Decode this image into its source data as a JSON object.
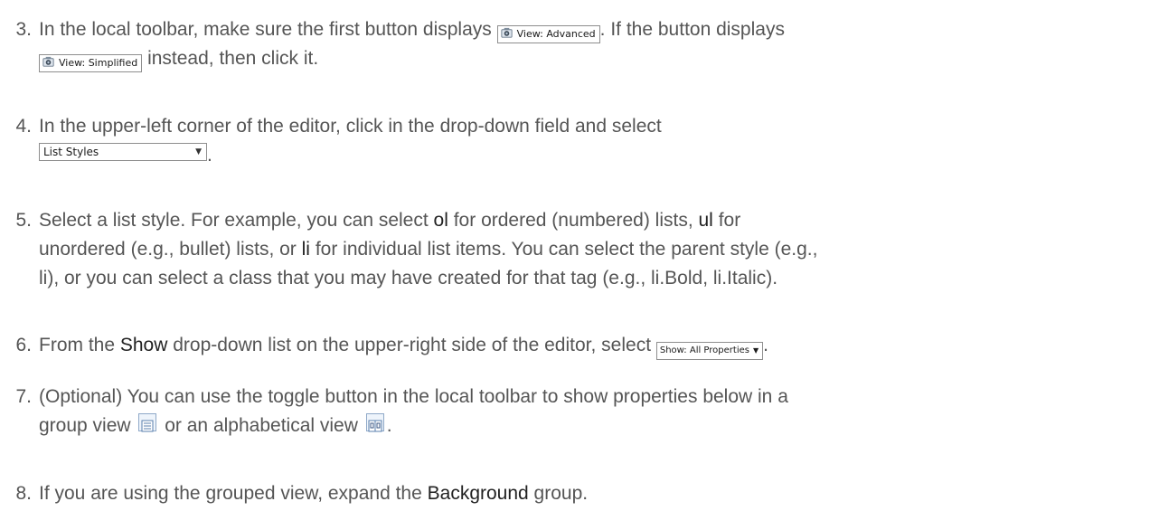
{
  "steps": [
    {
      "number": "3.",
      "part1": "In the local toolbar, make sure the first button displays",
      "btn_advanced": "View: Advanced",
      "part2": ". If the button displays",
      "btn_simplified": "View: Simplified",
      "part3": "instead, then click it."
    },
    {
      "number": "4.",
      "part1": "In the upper-left corner of the editor, click in the drop-down field and select",
      "select_value": "List Styles",
      "part2": "."
    },
    {
      "number": "5.",
      "part1": "Select a list style. For example, you can select ",
      "kw_ol": "ol",
      "part2": " for ordered (numbered) lists, ",
      "kw_ul": "ul",
      "part3": " for",
      "part4": "unordered (e.g., bullet) lists, or ",
      "kw_li": "li",
      "part5": " for individual list items. You can select the parent style (e.g.,",
      "part6": "li), or you can select a class that you may have created for that tag (e.g., li.Bold, li.Italic)."
    },
    {
      "number": "6.",
      "part1": "From the ",
      "kw_show": "Show",
      "part2": " drop-down list on the upper-right side of the editor, select",
      "show_value": "Show: All Properties",
      "part3": "."
    },
    {
      "number": "7.",
      "part1": "(Optional) You can use the toggle button in the local toolbar to show properties below in a",
      "part2": "group view",
      "part3": "or an alphabetical view",
      "part4": "."
    },
    {
      "number": "8.",
      "part1": "If you are using the grouped view, expand the ",
      "kw_background": "Background",
      "part2": " group."
    }
  ],
  "icons": {
    "view_icon": "camera-view-icon",
    "group_view_icon": "group-view-icon",
    "alpha_view_icon": "alphabetical-view-icon"
  }
}
